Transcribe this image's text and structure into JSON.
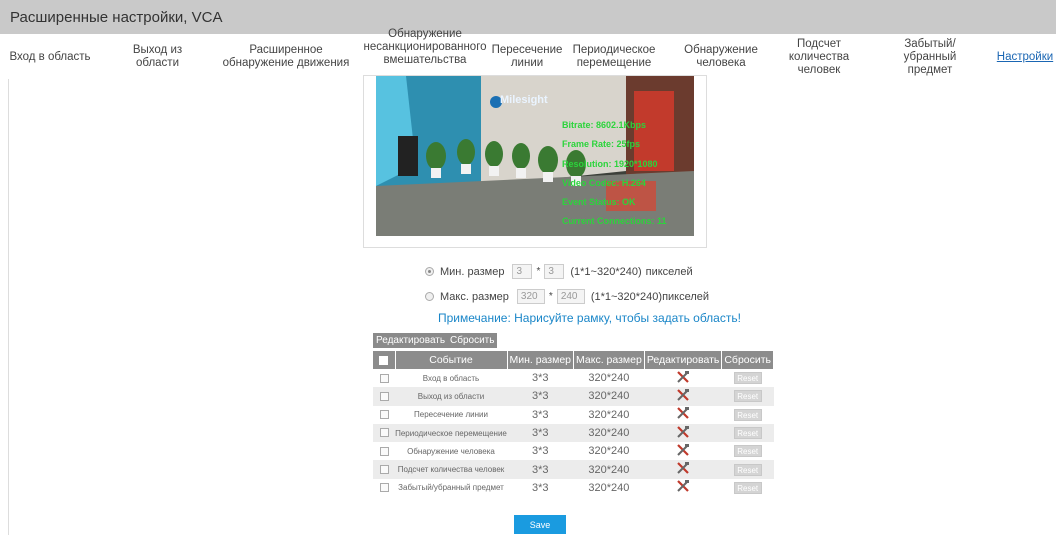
{
  "window": {
    "title": "Расширенные настройки, VCA"
  },
  "tabs": [
    {
      "label": "Вход в область"
    },
    {
      "label": "Выход из области"
    },
    {
      "label": "Расширенное обнаружение движения"
    },
    {
      "label": "Обнаружение несанкционированного вмешательства"
    },
    {
      "label": "Пересечение линии"
    },
    {
      "label": "Периодическое перемещение"
    },
    {
      "label": "Обнаружение человека"
    },
    {
      "label": "Подсчет количества человек"
    },
    {
      "label": "Забытый/убранный предмет"
    },
    {
      "label": "Настройки",
      "active": true
    }
  ],
  "preview": {
    "logo": "Milesight",
    "osd": [
      "Bitrate: 8602.1Kbps",
      "Frame Rate: 25fps",
      "Resolution: 1920*1080",
      "Video Codec: H.264",
      "Event Status: OK",
      "Current Connections: 11"
    ]
  },
  "min_size": {
    "label": "Мин. размер",
    "w": "3",
    "h": "3",
    "range": "(1*1~320*240)",
    "unit": "пикселей",
    "selected": true
  },
  "max_size": {
    "label": "Макс. размер",
    "w": "320",
    "h": "240",
    "range": "(1*1~320*240)",
    "unit": "пикселей",
    "selected": false
  },
  "note": "Примечание: Нарисуйте рамку, чтобы задать область!",
  "toolbar": {
    "edit_label": "Редактировать",
    "reset_label": "Сбросить"
  },
  "table": {
    "headers": [
      "Событие",
      "Мин. размер",
      "Макс. размер",
      "Редактировать",
      "Сбросить"
    ],
    "rows": [
      {
        "event": "Вход в область",
        "min": "3*3",
        "max": "320*240",
        "reset": "Reset"
      },
      {
        "event": "Выход из области",
        "min": "3*3",
        "max": "320*240",
        "reset": "Reset"
      },
      {
        "event": "Пересечение линии",
        "min": "3*3",
        "max": "320*240",
        "reset": "Reset"
      },
      {
        "event": "Периодическое перемещение",
        "min": "3*3",
        "max": "320*240",
        "reset": "Reset"
      },
      {
        "event": "Обнаружение человека",
        "min": "3*3",
        "max": "320*240",
        "reset": "Reset"
      },
      {
        "event": "Подсчет количества человек",
        "min": "3*3",
        "max": "320*240",
        "reset": "Reset"
      },
      {
        "event": "Забытый/убранный предмет",
        "min": "3*3",
        "max": "320*240",
        "reset": "Reset"
      }
    ]
  },
  "save_label": "Save",
  "colors": {
    "accent": "#1a9be0",
    "osd": "#2bd43b",
    "title_bar": "#c9c9c9",
    "header": "#8c8c8c"
  },
  "icons": {
    "edit": "tools-icon"
  }
}
